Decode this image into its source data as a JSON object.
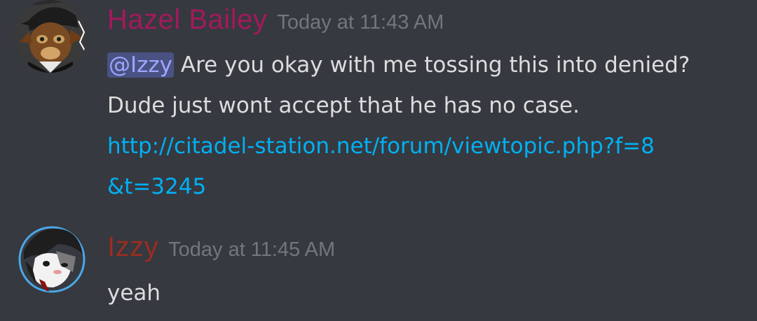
{
  "messages": [
    {
      "author": "Hazel Bailey",
      "author_color": "#a3195c",
      "timestamp": "Today at 11:43 AM",
      "mention": "@Izzy",
      "text_line1": " Are you okay with me tossing this into denied?",
      "text_line2": "Dude just wont accept that he has no case.",
      "link_line1": "http://citadel-station.net/forum/viewtopic.php?f=8",
      "link_line2": "&t=3245",
      "avatar_icon": "avatar-hazel-icon"
    },
    {
      "author": "Izzy",
      "author_color": "#992d22",
      "timestamp": "Today at 11:45 AM",
      "text": "yeah",
      "avatar_icon": "avatar-izzy-icon"
    }
  ],
  "colors": {
    "background": "#36393f",
    "text": "#dcddde",
    "timestamp": "#72767d",
    "link": "#00b0f4",
    "mention_bg": "#4a5283",
    "mention_text": "#9da6ff"
  }
}
